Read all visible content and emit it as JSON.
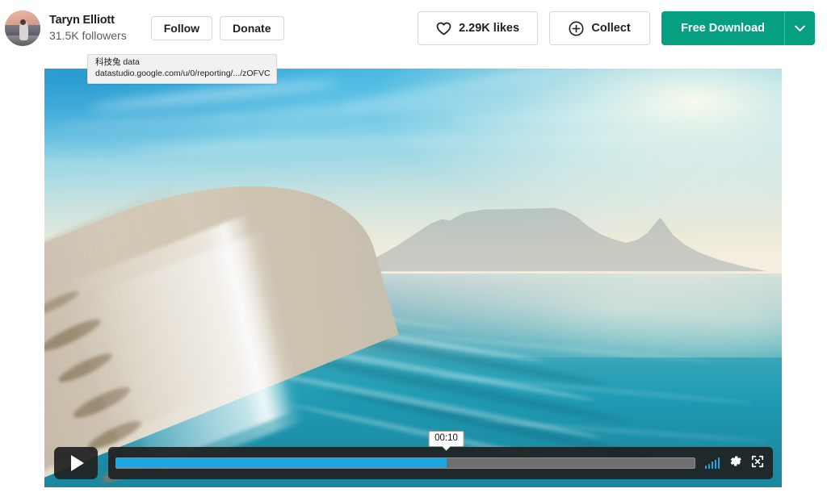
{
  "author": {
    "name": "Taryn Elliott",
    "followers": "31.5K followers",
    "avatar_icon": "user-avatar-photo"
  },
  "buttons": {
    "follow": "Follow",
    "donate": "Donate",
    "likes": "2.29K likes",
    "likes_icon": "heart-icon",
    "collect": "Collect",
    "collect_icon": "plus-circle-icon",
    "download": "Free Download",
    "download_caret_icon": "chevron-down-icon"
  },
  "link_tooltip": {
    "title": "科技兔 data",
    "url": "datastudio.google.com/u/0/reporting/.../zOFVC"
  },
  "video": {
    "play_icon": "play-triangle-icon",
    "current_time": "00:10",
    "progress_percent": "57.1",
    "volume_icon": "volume-bars-icon",
    "settings_icon": "gear-icon",
    "fullscreen_icon": "fullscreen-arrows-icon",
    "scene_alt": "Aerial view of a turquoise ocean beach with Table Mountain in the hazy distance"
  },
  "colors": {
    "brand_green": "#05a081",
    "progress_blue": "#1fa5e0",
    "control_dark": "#202020",
    "border_gray": "#d6d6d6"
  }
}
